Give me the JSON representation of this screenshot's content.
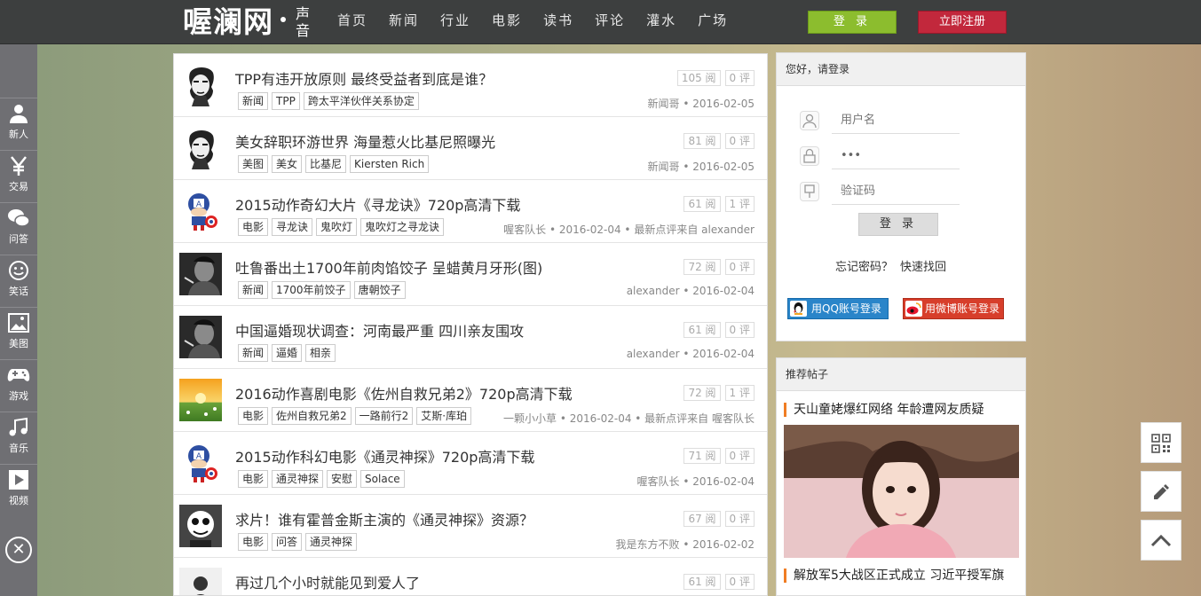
{
  "header": {
    "logo_text": "喔澜网",
    "logo_sub": "声音",
    "nav": [
      "首页",
      "新闻",
      "行业",
      "电影",
      "读书",
      "评论",
      "灌水",
      "广场"
    ],
    "login_label": "登 录",
    "register_label": "立即注册"
  },
  "sidebar": {
    "items": [
      {
        "label": "新人",
        "icon": "user-icon"
      },
      {
        "label": "交易",
        "icon": "yen-icon"
      },
      {
        "label": "问答",
        "icon": "chat-icon"
      },
      {
        "label": "笑话",
        "icon": "smile-icon"
      },
      {
        "label": "美图",
        "icon": "image-icon"
      },
      {
        "label": "游戏",
        "icon": "gamepad-icon"
      },
      {
        "label": "音乐",
        "icon": "music-icon"
      },
      {
        "label": "视频",
        "icon": "video-icon"
      }
    ],
    "close_glyph": "✕"
  },
  "posts": [
    {
      "title": "TPP有违开放原则 最终受益者到底是谁？",
      "tags": [
        "新闻",
        "TPP",
        "跨太平洋伙伴关系协定"
      ],
      "views": "105 阅",
      "comments": "0 评",
      "meta": "新闻哥 • 2016-02-05",
      "avatar": "sketch"
    },
    {
      "title": "美女辞职环游世界 海量惹火比基尼照曝光",
      "tags": [
        "美图",
        "美女",
        "比基尼",
        "Kiersten Rich"
      ],
      "views": "81 阅",
      "comments": "0 评",
      "meta": "新闻哥 • 2016-02-05",
      "avatar": "sketch"
    },
    {
      "title": "2015动作奇幻大片《寻龙诀》720p高清下载",
      "tags": [
        "电影",
        "寻龙诀",
        "鬼吹灯",
        "鬼吹灯之寻龙诀"
      ],
      "views": "61 阅",
      "comments": "1 评",
      "meta": "喔客队长 • 2016-02-04 • 最新点评来自 alexander",
      "avatar": "captain"
    },
    {
      "title": "吐鲁番出土1700年前肉馅饺子 呈蜡黄月牙形(图)",
      "tags": [
        "新闻",
        "1700年前饺子",
        "唐朝饺子"
      ],
      "views": "72 阅",
      "comments": "0 评",
      "meta": "alexander • 2016-02-04",
      "avatar": "photo"
    },
    {
      "title": "中国逼婚现状调查：河南最严重 四川亲友围攻",
      "tags": [
        "新闻",
        "逼婚",
        "相亲"
      ],
      "views": "61 阅",
      "comments": "0 评",
      "meta": "alexander • 2016-02-04",
      "avatar": "photo"
    },
    {
      "title": "2016动作喜剧电影《佐州自救兄弟2》720p高清下载",
      "tags": [
        "电影",
        "佐州自救兄弟2",
        "一路前行2",
        "艾斯·库珀"
      ],
      "views": "72 阅",
      "comments": "1 评",
      "meta": "一颗小小草 • 2016-02-04 • 最新点评来自 喔客队长",
      "avatar": "sunset"
    },
    {
      "title": "2015动作科幻电影《通灵神探》720p高清下载",
      "tags": [
        "电影",
        "通灵神探",
        "安慰",
        "Solace"
      ],
      "views": "71 阅",
      "comments": "0 评",
      "meta": "喔客队长 • 2016-02-04",
      "avatar": "captain"
    },
    {
      "title": "求片！谁有霍普金斯主演的《通灵神探》资源？",
      "tags": [
        "电影",
        "问答",
        "通灵神探"
      ],
      "views": "67 阅",
      "comments": "0 评",
      "meta": "我是东方不败 • 2016-02-02",
      "avatar": "cartoon"
    },
    {
      "title": "再过几个小时就能见到爱人了",
      "tags": [],
      "views": "61 阅",
      "comments": "0 评",
      "meta": "",
      "avatar": "silhouette"
    }
  ],
  "login_panel": {
    "greeting": "您好，请登录",
    "username_placeholder": "用户名",
    "password_value": "•••",
    "captcha_placeholder": "验证码",
    "submit_label": "登 录",
    "forgot_label": "忘记密码？",
    "recover_link": "快速找回",
    "qq_login": "用QQ账号登录",
    "weibo_login": "用微博账号登录"
  },
  "recommended": {
    "heading": "推荐帖子",
    "items": [
      "天山童姥爆红网络 年龄遭网友质疑",
      "解放军5大战区正式成立 习近平授军旗"
    ]
  },
  "float_buttons": [
    "qrcode-icon",
    "edit-icon",
    "back-to-top-icon"
  ],
  "colors": {
    "topbar": "#3d3f3f",
    "login_btn": "#8cbd2e",
    "register_btn": "#c2283c",
    "accent_orange": "#f07d24",
    "qq_blue": "#2a85c9",
    "weibo_red": "#d73e2b"
  }
}
